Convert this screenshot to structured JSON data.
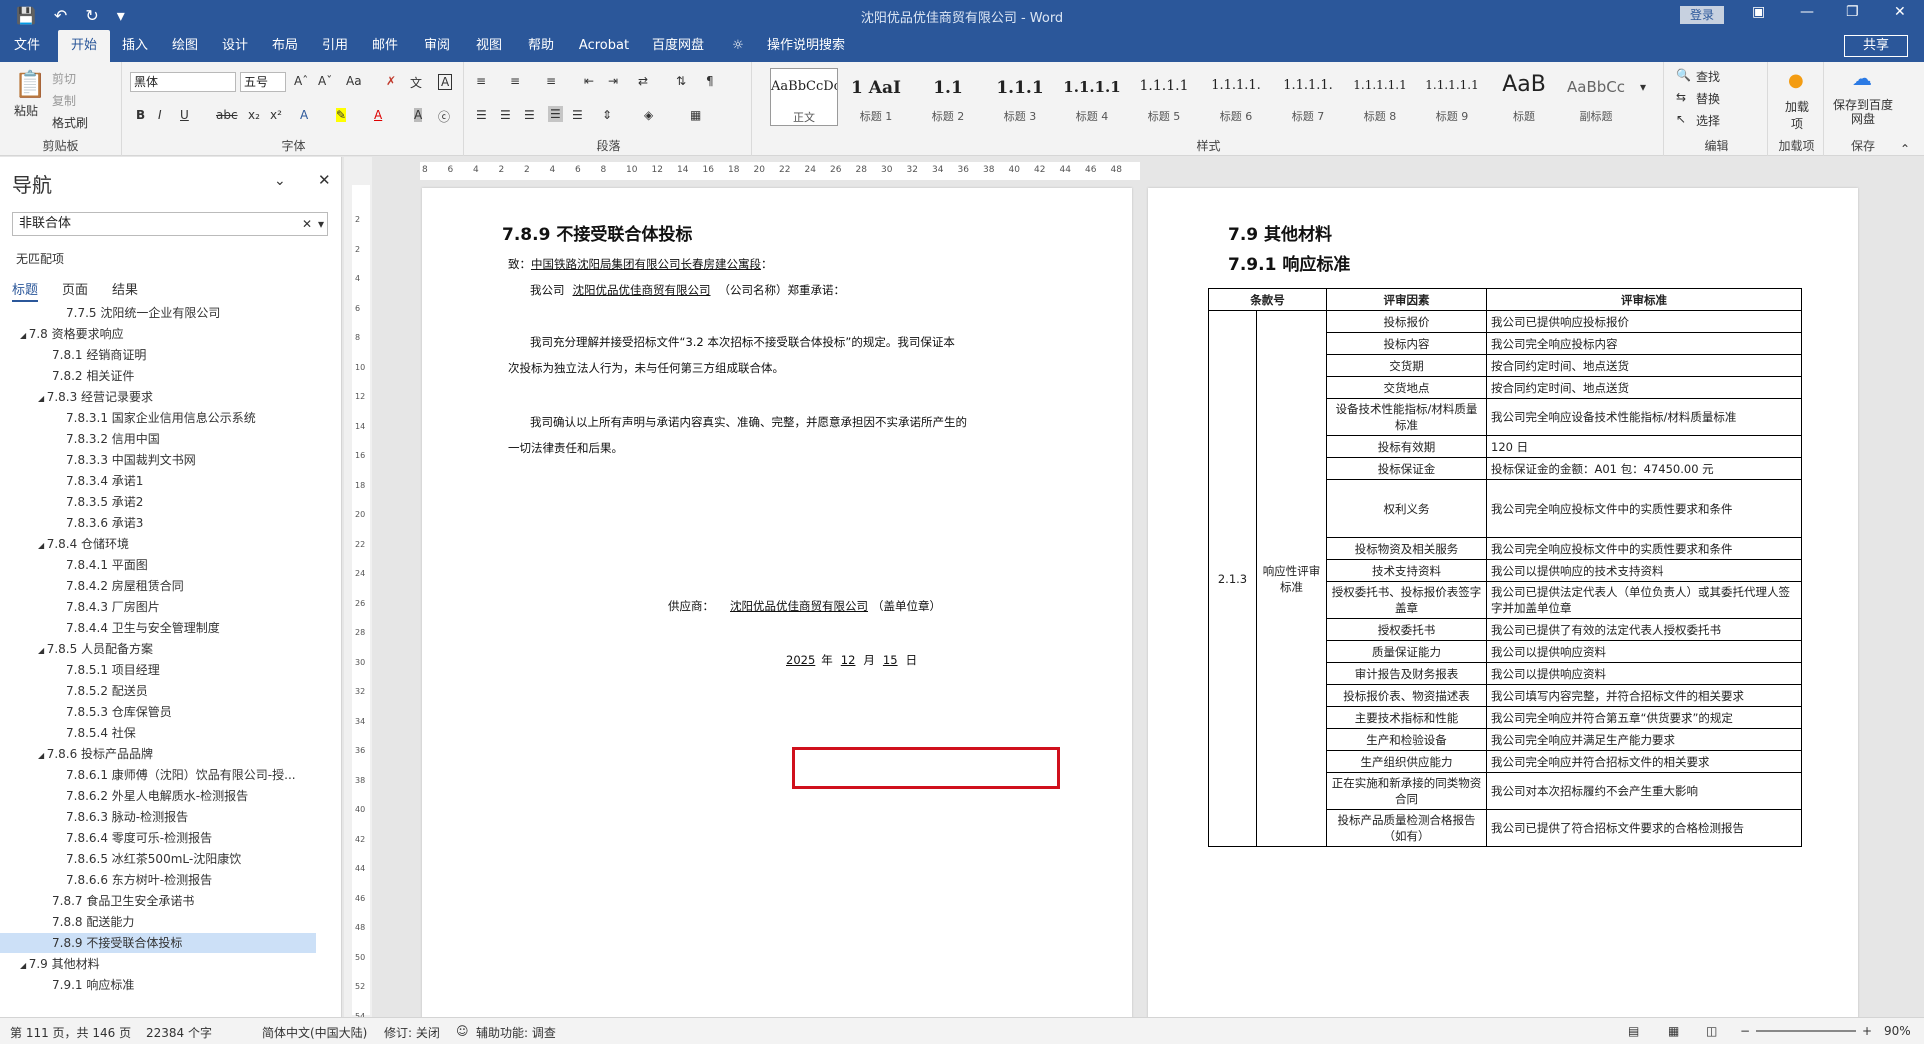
{
  "window": {
    "title": "沈阳优品优佳商贸有限公司 - Word",
    "login": "登录",
    "share": "共享"
  },
  "tabs": [
    "文件",
    "开始",
    "插入",
    "绘图",
    "设计",
    "布局",
    "引用",
    "邮件",
    "审阅",
    "视图",
    "帮助",
    "Acrobat",
    "百度网盘",
    "操作说明搜索"
  ],
  "ribbon": {
    "clipboard": {
      "paste": "粘贴",
      "cut": "剪切",
      "copy": "复制",
      "format_painter": "格式刷",
      "label": "剪贴板"
    },
    "font": {
      "name": "黑体",
      "size": "五号",
      "label": "字体"
    },
    "paragraph": {
      "label": "段落"
    },
    "styles": {
      "items": [
        {
          "preview": "AaBbCcDc",
          "name": "正文"
        },
        {
          "preview": "1 AaI",
          "name": "标题 1"
        },
        {
          "preview": "1.1",
          "name": "标题 2"
        },
        {
          "preview": "1.1.1",
          "name": "标题 3"
        },
        {
          "preview": "1.1.1.1",
          "name": "标题 4"
        },
        {
          "preview": "1.1.1.1",
          "name": "标题 5"
        },
        {
          "preview": "1.1.1.1.",
          "name": "标题 6"
        },
        {
          "preview": "1.1.1.1.",
          "name": "标题 7"
        },
        {
          "preview": "1.1.1.1.1",
          "name": "标题 8"
        },
        {
          "preview": "1.1.1.1.1",
          "name": "标题 9"
        },
        {
          "preview": "AaB",
          "name": "标题"
        },
        {
          "preview": "AaBbCc",
          "name": "副标题"
        }
      ],
      "label": "样式"
    },
    "editing": {
      "find": "查找",
      "replace": "替换",
      "select": "选择",
      "label": "编辑"
    },
    "addins": {
      "btn": "加载项",
      "label": "加载项"
    },
    "save": {
      "btn": "保存到百度网盘",
      "label": "保存"
    }
  },
  "nav": {
    "title": "导航",
    "search": "非联合体",
    "no_match": "无匹配项",
    "tabs": [
      "标题",
      "页面",
      "结果"
    ],
    "items": [
      {
        "t": "7.7.5 沈阳统一企业有限公司",
        "l": 4
      },
      {
        "t": "7.8 资格要求响应",
        "l": 2,
        "c": true
      },
      {
        "t": "7.8.1 经销商证明",
        "l": 3
      },
      {
        "t": "7.8.2 相关证件",
        "l": 3
      },
      {
        "t": "7.8.3 经营记录要求",
        "l": 3,
        "c": true
      },
      {
        "t": "7.8.3.1 国家企业信用信息公示系统",
        "l": 4
      },
      {
        "t": "7.8.3.2 信用中国",
        "l": 4
      },
      {
        "t": "7.8.3.3 中国裁判文书网",
        "l": 4
      },
      {
        "t": "7.8.3.4 承诺1",
        "l": 4
      },
      {
        "t": "7.8.3.5 承诺2",
        "l": 4
      },
      {
        "t": "7.8.3.6 承诺3",
        "l": 4
      },
      {
        "t": "7.8.4 仓储环境",
        "l": 3,
        "c": true
      },
      {
        "t": "7.8.4.1 平面图",
        "l": 4
      },
      {
        "t": "7.8.4.2 房屋租赁合同",
        "l": 4
      },
      {
        "t": "7.8.4.3 厂房图片",
        "l": 4
      },
      {
        "t": "7.8.4.4 卫生与安全管理制度",
        "l": 4
      },
      {
        "t": "7.8.5 人员配备方案",
        "l": 3,
        "c": true
      },
      {
        "t": "7.8.5.1 项目经理",
        "l": 4
      },
      {
        "t": "7.8.5.2 配送员",
        "l": 4
      },
      {
        "t": "7.8.5.3 仓库保管员",
        "l": 4
      },
      {
        "t": "7.8.5.4 社保",
        "l": 4
      },
      {
        "t": "7.8.6 投标产品品牌",
        "l": 3,
        "c": true
      },
      {
        "t": "7.8.6.1 康师傅（沈阳）饮品有限公司-授...",
        "l": 4
      },
      {
        "t": "7.8.6.2 外星人电解质水-检测报告",
        "l": 4
      },
      {
        "t": "7.8.6.3 脉动-检测报告",
        "l": 4
      },
      {
        "t": "7.8.6.4 零度可乐-检测报告",
        "l": 4
      },
      {
        "t": "7.8.6.5 冰红茶500mL-沈阳康饮",
        "l": 4
      },
      {
        "t": "7.8.6.6 东方树叶-检测报告",
        "l": 4
      },
      {
        "t": "7.8.7 食品卫生安全承诺书",
        "l": 3
      },
      {
        "t": "7.8.8 配送能力",
        "l": 3
      },
      {
        "t": "7.8.9 不接受联合体投标",
        "l": 3,
        "sel": true
      },
      {
        "t": "7.9 其他材料",
        "l": 2,
        "c": true
      },
      {
        "t": "7.9.1 响应标准",
        "l": 3
      }
    ]
  },
  "ruler": {
    "h": [
      "8",
      "6",
      "4",
      "2",
      "2",
      "4",
      "6",
      "8",
      "10",
      "12",
      "14",
      "16",
      "18",
      "20",
      "22",
      "24",
      "26",
      "28",
      "30",
      "32",
      "34",
      "36",
      "38",
      "40",
      "42",
      "44",
      "46",
      "48"
    ],
    "v": [
      "2",
      "2",
      "4",
      "6",
      "8",
      "10",
      "12",
      "14",
      "16",
      "18",
      "20",
      "22",
      "24",
      "26",
      "28",
      "30",
      "32",
      "34",
      "36",
      "38",
      "40",
      "42",
      "44",
      "46",
      "48",
      "50",
      "52",
      "54"
    ]
  },
  "page1": {
    "heading": "7.8.9 不接受联合体投标",
    "to_prefix": "致：",
    "to_name": "中国铁路沈阳局集团有限公司长春房建公寓段",
    "to_suffix": "：",
    "p1_a": "我公司",
    "p1_company": "沈阳优品优佳商贸有限公司",
    "p1_b": "（公司名称）郑重承诺：",
    "p2_l1": "我司充分理解并接受招标文件“3.2 本次招标不接受联合体投标”的规定。我司保证本",
    "p2_l2": "次投标为独立法人行为，未与任何第三方组成联合体。",
    "p3_l1": "我司确认以上所有声明与承诺内容真实、准确、完整，并愿意承担因不实承诺所产生的",
    "p3_l2": "一切法律责任和后果。",
    "supplier_label": "供应商：",
    "supplier_name": "沈阳优品优佳商贸有限公司",
    "seal": "（盖单位章）",
    "year": "2025",
    "y_lbl": "年",
    "month": "12",
    "m_lbl": "月",
    "day": "15",
    "d_lbl": "日"
  },
  "page2": {
    "h1": "7.9 其他材料",
    "h2": "7.9.1 响应标准",
    "headers": [
      "条款号",
      "评审因素",
      "评审标准"
    ],
    "clause": "2.1.3",
    "category": "响应性评审标准",
    "rows": [
      {
        "f": "投标报价",
        "s": "我公司已提供响应投标报价"
      },
      {
        "f": "投标内容",
        "s": "我公司完全响应投标内容"
      },
      {
        "f": "交货期",
        "s": "按合同约定时间、地点送货"
      },
      {
        "f": "交货地点",
        "s": "按合同约定时间、地点送货"
      },
      {
        "f": "设备技术性能指标/材料质量标准",
        "s": "我公司完全响应设备技术性能指标/材料质量标准"
      },
      {
        "f": "投标有效期",
        "s": "120 日"
      },
      {
        "f": "投标保证金",
        "s": "投标保证金的金额：A01 包：47450.00 元"
      },
      {
        "f": "权利义务",
        "s": "我公司完全响应投标文件中的实质性要求和条件",
        "tall": true
      },
      {
        "f": "投标物资及相关服务",
        "s": "我公司完全响应投标文件中的实质性要求和条件"
      },
      {
        "f": "技术支持资料",
        "s": "我公司以提供响应的技术支持资料"
      },
      {
        "f": "授权委托书、投标报价表签字盖章",
        "s": "我公司已提供法定代表人（单位负责人）或其委托代理人签字并加盖单位章"
      },
      {
        "f": "授权委托书",
        "s": "我公司已提供了有效的法定代表人授权委托书"
      },
      {
        "f": "质量保证能力",
        "s": "我公司以提供响应资料"
      },
      {
        "f": "审计报告及财务报表",
        "s": "我公司以提供响应资料"
      },
      {
        "f": "投标报价表、物资描述表",
        "s": "我公司填写内容完整，并符合招标文件的相关要求"
      },
      {
        "f": "主要技术指标和性能",
        "s": "我公司完全响应并符合第五章“供货要求”的规定"
      },
      {
        "f": "生产和检验设备",
        "s": "我公司完全响应并满足生产能力要求"
      },
      {
        "f": "生产组织供应能力",
        "s": "我公司完全响应并符合招标文件的相关要求"
      },
      {
        "f": "正在实施和新承接的同类物资合同",
        "s": "我公司对本次招标履约不会产生重大影响"
      },
      {
        "f": "投标产品质量检测合格报告（如有）",
        "s": "我公司已提供了符合招标文件要求的合格检测报告"
      }
    ]
  },
  "status": {
    "page": "第 111 页，共 146 页",
    "words": "22384 个字",
    "lang": "简体中文(中国大陆)",
    "track": "修订: 关闭",
    "access": "辅助功能: 调查",
    "zoom": "90%"
  }
}
